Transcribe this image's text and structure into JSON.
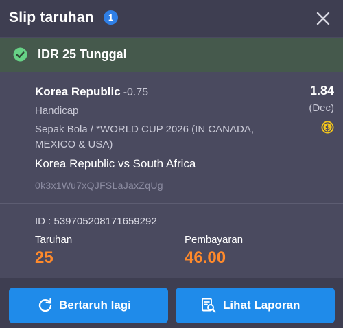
{
  "header": {
    "title": "Slip taruhan",
    "count_badge": "1",
    "close_icon": "close-icon"
  },
  "confirmation": {
    "icon": "check-circle-icon",
    "text": "IDR 25 Tunggal",
    "color": "#45594c"
  },
  "bet": {
    "team": "Korea Republic",
    "handicap": "-0.75",
    "market": "Handicap",
    "league": "Sepak Bola / *WORLD CUP 2026 (IN CANADA, MEXICO & USA)",
    "match": "Korea Republic vs South Africa",
    "ref_code": "0k3x1Wu7xQJFSLaJaxZqUg",
    "odds": "1.84",
    "odds_format": "(Dec)",
    "coin_icon": "dollar-coin-icon"
  },
  "summary": {
    "ticket_id": "ID : 539705208171659292",
    "stake_label": "Taruhan",
    "stake_value": "25",
    "payout_label": "Pembayaran",
    "payout_value": "46.00",
    "accent": "#ff8a2b"
  },
  "actions": {
    "retry_label": "Bertaruh lagi",
    "retry_icon": "refresh-icon",
    "report_label": "Lihat Laporan",
    "report_icon": "report-search-icon",
    "button_color": "#1f8bea"
  }
}
